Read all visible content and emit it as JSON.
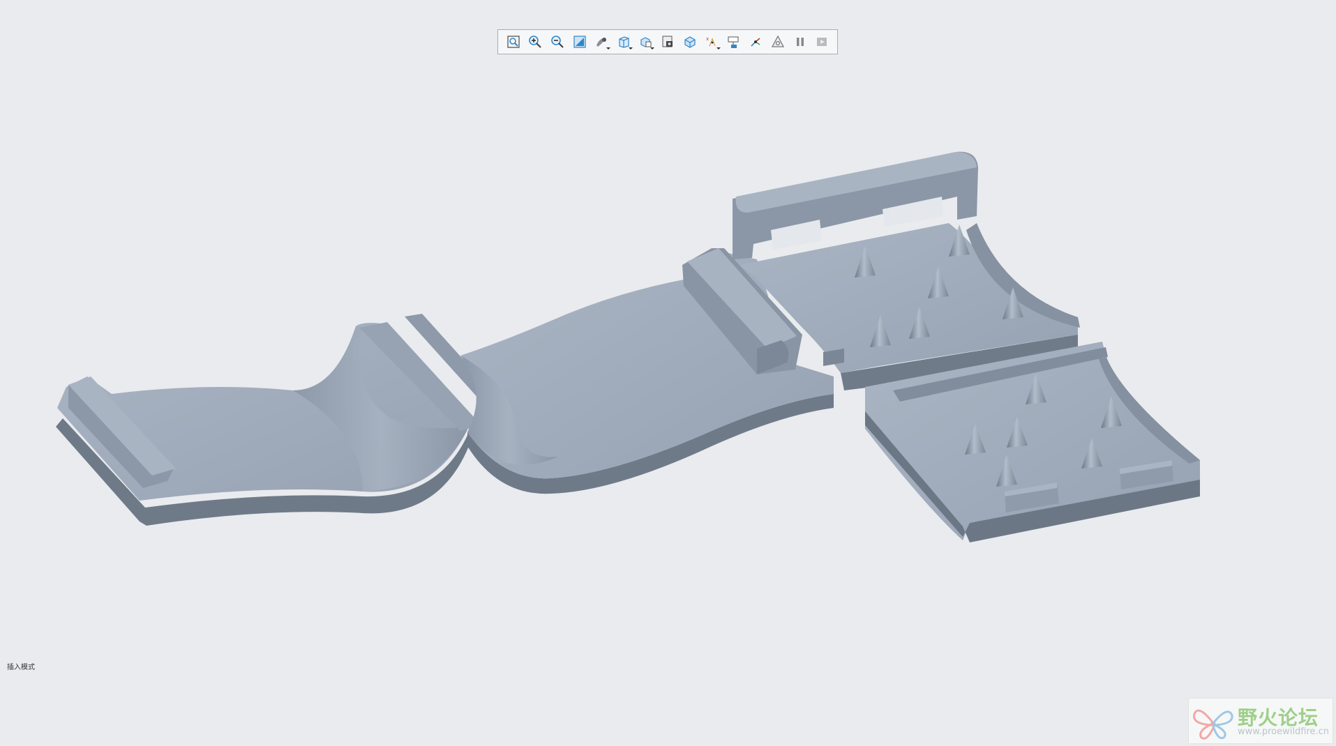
{
  "toolbar": {
    "buttons": [
      {
        "name": "refit-icon",
        "flyout": false
      },
      {
        "name": "zoom-in-icon",
        "flyout": false
      },
      {
        "name": "zoom-out-icon",
        "flyout": false
      },
      {
        "name": "repaint-icon",
        "flyout": false
      },
      {
        "name": "display-style-icon",
        "flyout": true
      },
      {
        "name": "saved-orientations-icon",
        "flyout": true
      },
      {
        "name": "view-manager-icon",
        "flyout": true
      },
      {
        "name": "perspective-view-icon",
        "flyout": false
      },
      {
        "name": "section-icon",
        "flyout": false
      },
      {
        "name": "datum-display-icon",
        "flyout": true
      },
      {
        "name": "annotation-display-icon",
        "flyout": false
      },
      {
        "name": "spin-center-icon",
        "flyout": false
      },
      {
        "name": "analysis-icon",
        "flyout": false
      },
      {
        "name": "pause-icon",
        "flyout": false
      },
      {
        "name": "next-icon",
        "flyout": false
      }
    ]
  },
  "status": {
    "text": "插入模式"
  },
  "watermark": {
    "title": "野火论坛",
    "url": "www.proewildfire.cn"
  },
  "colors": {
    "background": "#e9ebee",
    "model_top": "#a3afbf",
    "model_side": "#7a8594",
    "model_dark": "#636d7a",
    "toolbar_accent": "#2f86c9"
  }
}
